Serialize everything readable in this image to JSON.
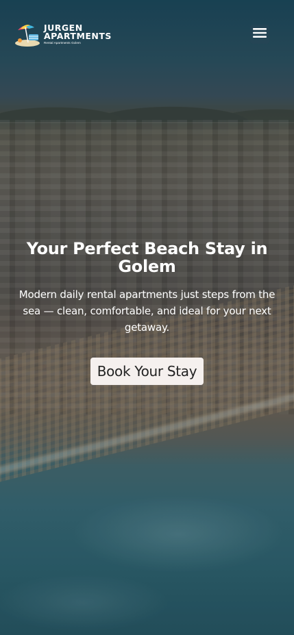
{
  "header": {
    "logo_title_line1": "JURGEN",
    "logo_title_line2": "APARTMENTS",
    "logo_subtitle": "Rental Apartments Golem",
    "menu_icon": "hamburger-menu-icon"
  },
  "hero": {
    "title": "Your Perfect Beach Stay in Golem",
    "description": "Modern daily rental apartments just steps from the sea — clean, comfortable, and ideal for your next getaway.",
    "cta_label": "Book Your Stay"
  },
  "colors": {
    "cta_background": "#f5f0ee",
    "cta_text": "#222222",
    "hero_text": "#ffffff"
  }
}
